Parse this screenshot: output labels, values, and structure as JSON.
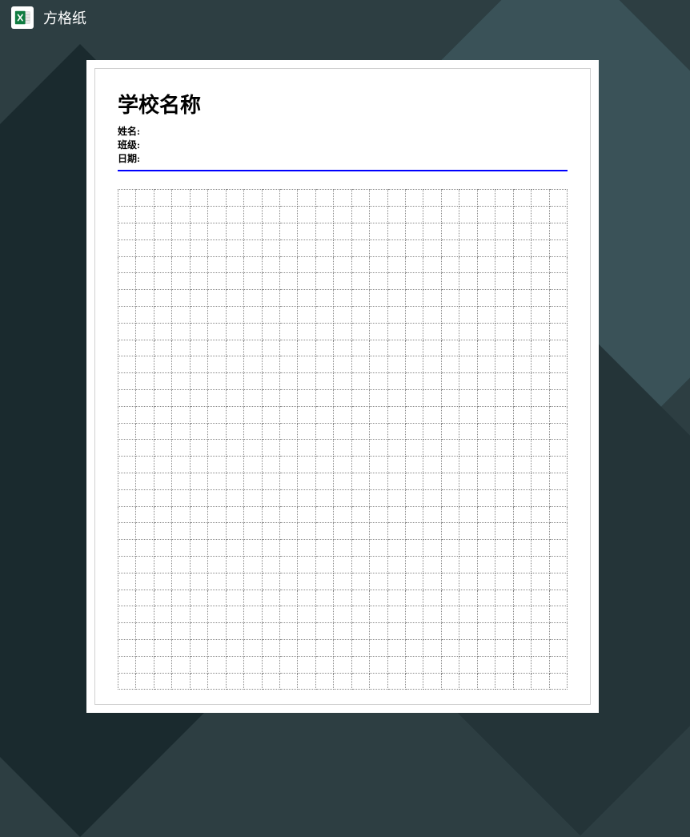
{
  "titlebar": {
    "filename": "方格纸"
  },
  "document": {
    "school_title": "学校名称",
    "name_label": "姓名:",
    "class_label": "班级:",
    "date_label": "日期:",
    "grid": {
      "columns": 25,
      "rows": 30
    }
  }
}
